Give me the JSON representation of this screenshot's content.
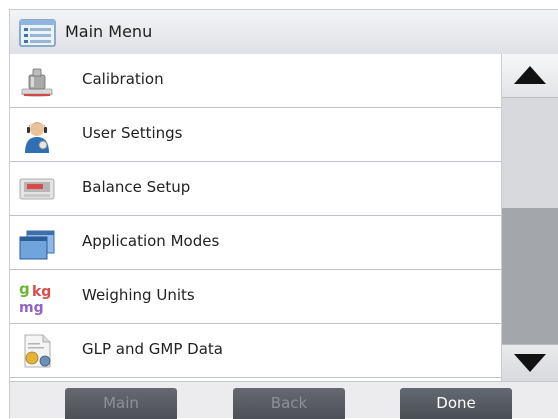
{
  "header": {
    "title": "Main Menu",
    "icon": "main-menu-list-icon"
  },
  "menu": {
    "items": [
      {
        "label": "Calibration",
        "icon": "calibration-weight-icon"
      },
      {
        "label": "User Settings",
        "icon": "user-settings-person-icon"
      },
      {
        "label": "Balance Setup",
        "icon": "balance-setup-icon"
      },
      {
        "label": "Application Modes",
        "icon": "application-modes-windows-icon"
      },
      {
        "label": "Weighing Units",
        "icon": "weighing-units-icon"
      },
      {
        "label": "GLP and GMP Data",
        "icon": "glp-gmp-document-icon"
      }
    ],
    "unit_glyphs": {
      "g": "g",
      "kg": "kg",
      "mg": "mg"
    }
  },
  "scrollbar": {
    "up_icon": "scroll-up-arrow-icon",
    "down_icon": "scroll-down-arrow-icon"
  },
  "footer": {
    "main_label": "Main",
    "main_enabled": false,
    "back_label": "Back",
    "back_enabled": false,
    "done_label": "Done",
    "done_enabled": true
  },
  "colors": {
    "title_bar": "#dfe1e5",
    "scroll_thumb": "#a3a6aa",
    "button_bg": "#565a60",
    "button_disabled_text": "#8d9196",
    "button_active_text": "#ffffff"
  }
}
